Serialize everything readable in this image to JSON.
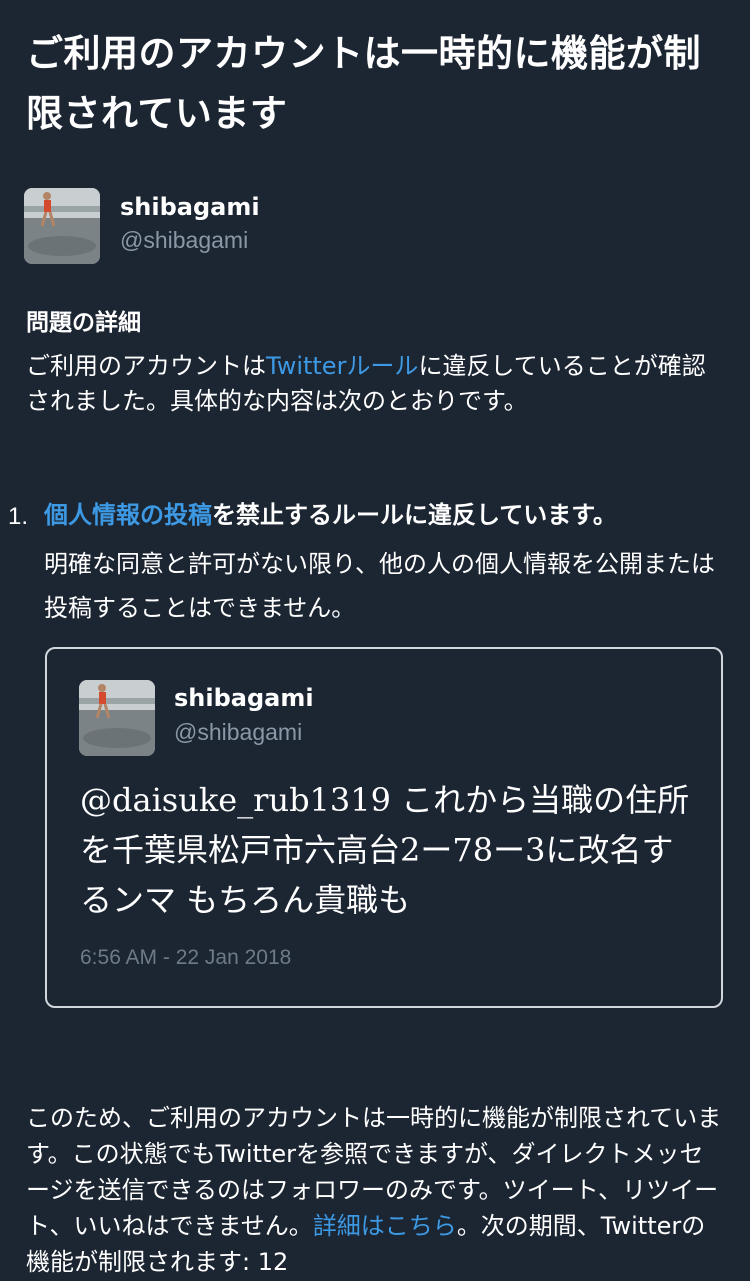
{
  "page": {
    "title": "ご利用のアカウントは一時的に機能が制限されています"
  },
  "account": {
    "display_name": "shibagami",
    "handle": "@shibagami",
    "avatar_icon": "profile-photo"
  },
  "details": {
    "heading": "問題の詳細",
    "intro_before": "ご利用のアカウントは",
    "intro_link": "Twitterルール",
    "intro_after": "に違反していることが確認されました。具体的な内容は次のとおりです。"
  },
  "violation": {
    "number": "1.",
    "link": "個人情報の投稿",
    "rule_text": "を禁止するルールに違反しています。",
    "description": "明確な同意と許可がない限り、他の人の個人情報を公開または投稿することはできません。"
  },
  "tweet": {
    "display_name": "shibagami",
    "handle": "@shibagami",
    "text": "@daisuke_rub1319 これから当職の住所を千葉県松戸市六高台2ー78ー3に改名するンマ もちろん貴職も",
    "timestamp": "6:56 AM - 22 Jan 2018"
  },
  "footer": {
    "text_before": "このため、ご利用のアカウントは一時的に機能が制限されています。この状態でもTwitterを参照できますが、ダイレクトメッセージを送信できるのはフォロワーのみです。ツイート、リツイート、いいねはできません。",
    "link": "詳細はこちら",
    "text_after": "。次の期間、Twitterの機能が制限されます: 12"
  },
  "colors": {
    "background": "#1c2532",
    "link": "#3d99e3",
    "muted": "#8b98a5"
  }
}
